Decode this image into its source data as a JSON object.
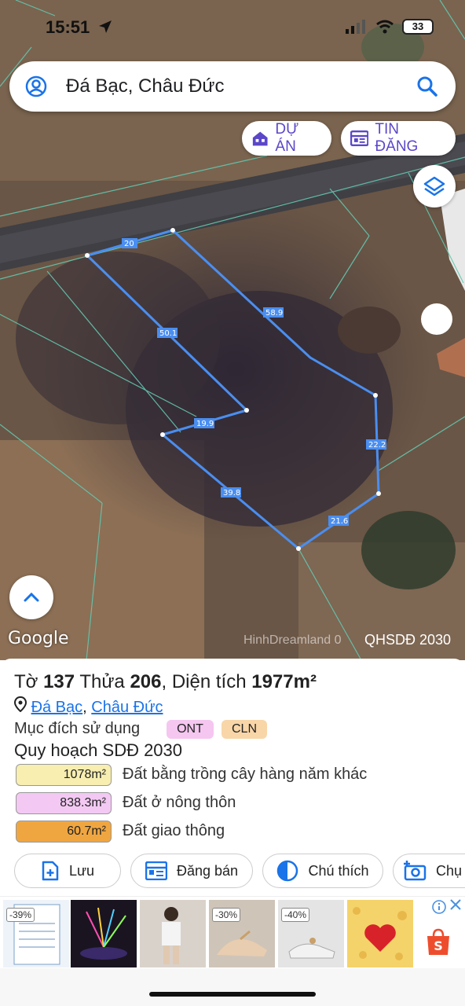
{
  "status": {
    "time": "15:51",
    "battery": "33"
  },
  "search": {
    "query": "Đá Bạc, Châu Đức"
  },
  "chips": {
    "du_an": "DỰ ÁN",
    "tin_dang": "TIN ĐĂNG"
  },
  "map": {
    "google": "Google",
    "watermark": "HinhDreamland 0",
    "qhsdd": "QHSDĐ 2030",
    "edges": [
      "20",
      "58.9",
      "50.1",
      "19.9",
      "22.2",
      "39.8",
      "21.6"
    ],
    "boundary_color": "#4a8ef0"
  },
  "parcel": {
    "to_label": "Tờ",
    "to_value": "137",
    "thua_label": "Thửa",
    "thua_value": "206",
    "area_label": ", Diện tích",
    "area_value": "1977m²",
    "commune": "Đá Bạc",
    "district": "Châu Đức",
    "purpose_label": "Mục đích sử dụng",
    "purposes": [
      "ONT",
      "CLN"
    ],
    "plan_title": "Quy hoạch SDĐ 2030",
    "plan": [
      {
        "area": "1078m²",
        "label": "Đất bằng trồng cây hàng năm khác",
        "color": "#f7eeb0"
      },
      {
        "area": "838.3m²",
        "label": "Đất ở nông thôn",
        "color": "#f3c9f3"
      },
      {
        "area": "60.7m²",
        "label": "Đất giao thông",
        "color": "#f0a640"
      }
    ]
  },
  "actions": {
    "save": "Lưu",
    "post": "Đăng bán",
    "legend": "Chú thích",
    "capture": "Chụ"
  },
  "ad": {
    "discounts": [
      "-39%",
      "-30%",
      "-40%"
    ]
  }
}
